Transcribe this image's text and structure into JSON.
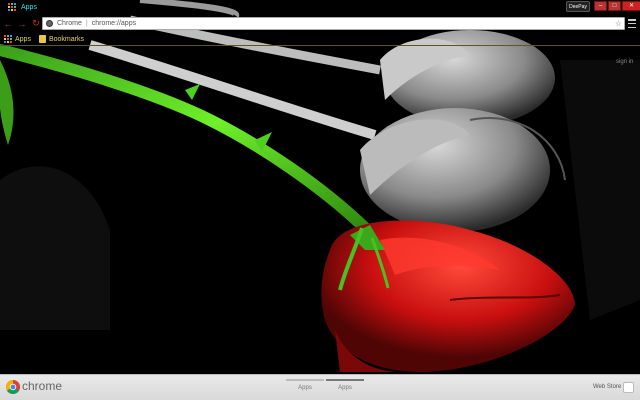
{
  "window": {
    "tab_title": "Apps",
    "profile_label": "DeePay",
    "controls": [
      "–",
      "□",
      "✕"
    ]
  },
  "toolbar": {
    "omnibox_chip": "Chrome",
    "omnibox_url": "chrome://apps"
  },
  "bookmarks": {
    "items": [
      {
        "label": "Apps",
        "icon": "apps-grid-icon"
      },
      {
        "label": "Bookmarks",
        "icon": "folder-icon"
      }
    ]
  },
  "account": {
    "signin_label": "sign in"
  },
  "bottom_bar": {
    "brand": "chrome",
    "pages": [
      {
        "label": "Apps",
        "active": false
      },
      {
        "label": "Apps",
        "active": true
      }
    ],
    "webstore_label": "Web Store"
  },
  "theme": {
    "tab_title_color": "#2ee6e6",
    "bookmark_text_color": "#e6d36a",
    "nav_icon_color": "#d03030",
    "rose_color": "#d81818",
    "stem_color": "#5ee021"
  }
}
